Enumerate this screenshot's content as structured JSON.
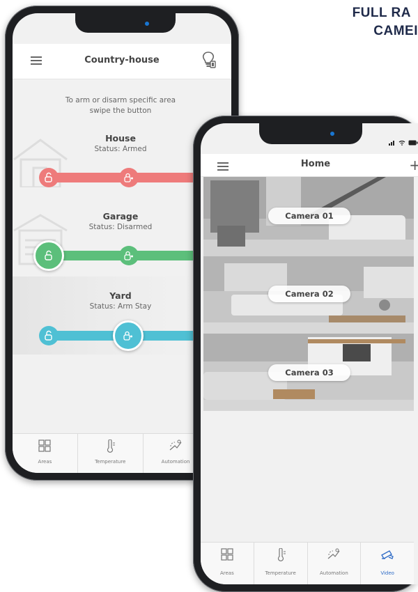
{
  "headline": {
    "line1": "FULL RA",
    "line2": "CAMEI"
  },
  "areas_screen": {
    "title": "Country-house",
    "hint": "To arm or disarm specific area swipe the button",
    "areas": [
      {
        "name": "House",
        "status": "Status: Armed",
        "color": "#ee7b7b"
      },
      {
        "name": "Garage",
        "status": "Status: Disarmed",
        "color": "#5cbf7b"
      },
      {
        "name": "Yard",
        "status": "Status: Arm Stay",
        "color": "#4fc0d4"
      }
    ],
    "icons": {
      "menu": "hamburger-icon",
      "top_right": "lightbulb-icon"
    },
    "tabs": [
      {
        "label": "Areas",
        "icon": "grid-icon"
      },
      {
        "label": "Temperature",
        "icon": "thermometer-icon"
      },
      {
        "label": "Automation",
        "icon": "automation-icon"
      }
    ]
  },
  "video_screen": {
    "title": "Home",
    "cameras": [
      {
        "label": "Camera 01"
      },
      {
        "label": "Camera 02"
      },
      {
        "label": "Camera 03"
      }
    ],
    "tabs": [
      {
        "label": "Areas",
        "icon": "grid-icon"
      },
      {
        "label": "Temperature",
        "icon": "thermometer-icon"
      },
      {
        "label": "Automation",
        "icon": "automation-icon"
      },
      {
        "label": "Video",
        "icon": "camera-icon",
        "active": true
      }
    ],
    "accent": "#2e6bc6"
  }
}
